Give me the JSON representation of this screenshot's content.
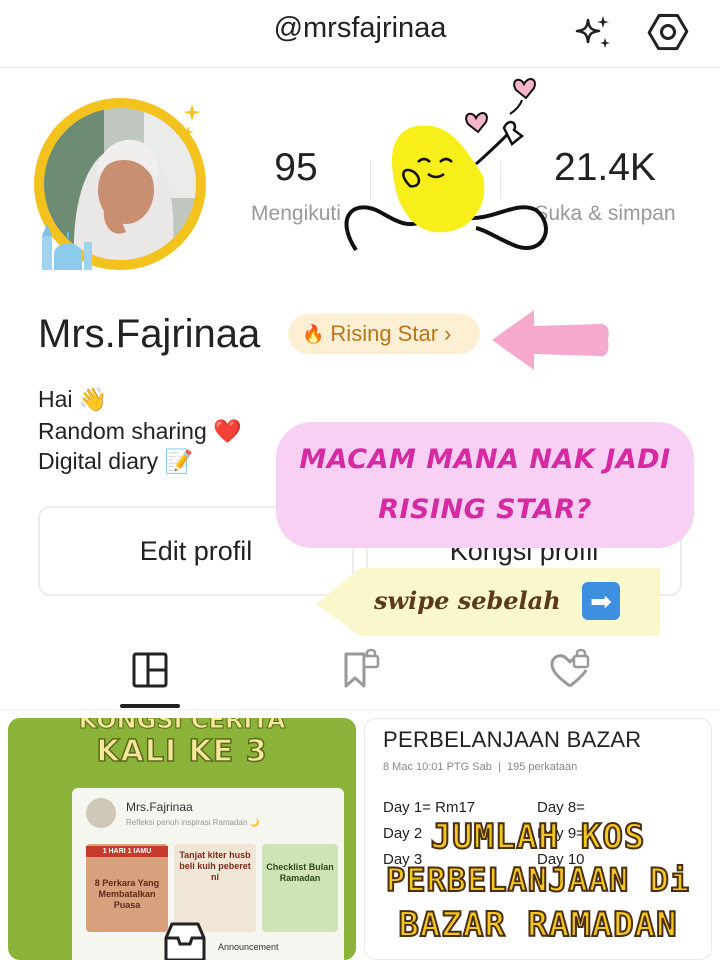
{
  "header": {
    "handle": "@mrsfajrinaa",
    "icons": [
      "sparkle-icon",
      "settings-gear-icon"
    ]
  },
  "profile": {
    "name": "Mrs.Fajrinaa",
    "badge": {
      "label": "Rising Star",
      "icon": "fire-icon"
    },
    "bio": [
      "Hai 👋",
      "Random sharing ❤️",
      "Digital diary 📝"
    ]
  },
  "stats": [
    {
      "value": "95",
      "label": "Mengikuti"
    },
    {
      "value": "",
      "label": ""
    },
    {
      "value": "21.4K",
      "label": "Suka & simpan"
    }
  ],
  "buttons": {
    "edit": "Edit profil",
    "share": "Kongsi profil"
  },
  "overlay": {
    "callout_line1": "MACAM MANA NAK JADI",
    "callout_line2": "RISING STAR?",
    "swipe": "swipe sebelah",
    "swipe_icon": "➡"
  },
  "tabs": [
    {
      "icon": "posts-grid-icon",
      "active": true
    },
    {
      "icon": "bookmark-lock-icon",
      "active": false
    },
    {
      "icon": "heart-lock-icon",
      "active": false
    }
  ],
  "posts": [
    {
      "top_text": "KONGSI CERITA",
      "title": "KALI KE 3",
      "inner_name": "Mrs.Fajrinaa",
      "inner_sub": "Refleksi penuh inspirasi Ramadan 🌙",
      "thumbs": [
        "8 Perkara Yang Membatalkan Puasa",
        "Tanjat kiter husb beli kuih peberet ni",
        "Checklist Bulan Ramadan"
      ],
      "thumb_badge": "1 HARI 1 IAMU",
      "announcement": "Announcement"
    },
    {
      "title": "PERBELANJAAN BAZAR",
      "meta_date": "8 Mac 10:01 PTG Sab",
      "meta_words": "195 perkataan",
      "days_left": [
        "Day 1= Rm17",
        "Day 2",
        "Day 3"
      ],
      "days_right": [
        "Day 8=",
        "Day 9=",
        "Day 10"
      ],
      "overlay": [
        "JUMLAH KOS",
        "PERBELANJAAN Di",
        "BAZAR RAMADAN"
      ]
    }
  ],
  "colors": {
    "accent_gold": "#f4c21c",
    "callout_pink": "#f7d0f3",
    "callout_text": "#d62aa3",
    "badge_bg": "#fcefd3",
    "badge_text": "#b8761a"
  }
}
